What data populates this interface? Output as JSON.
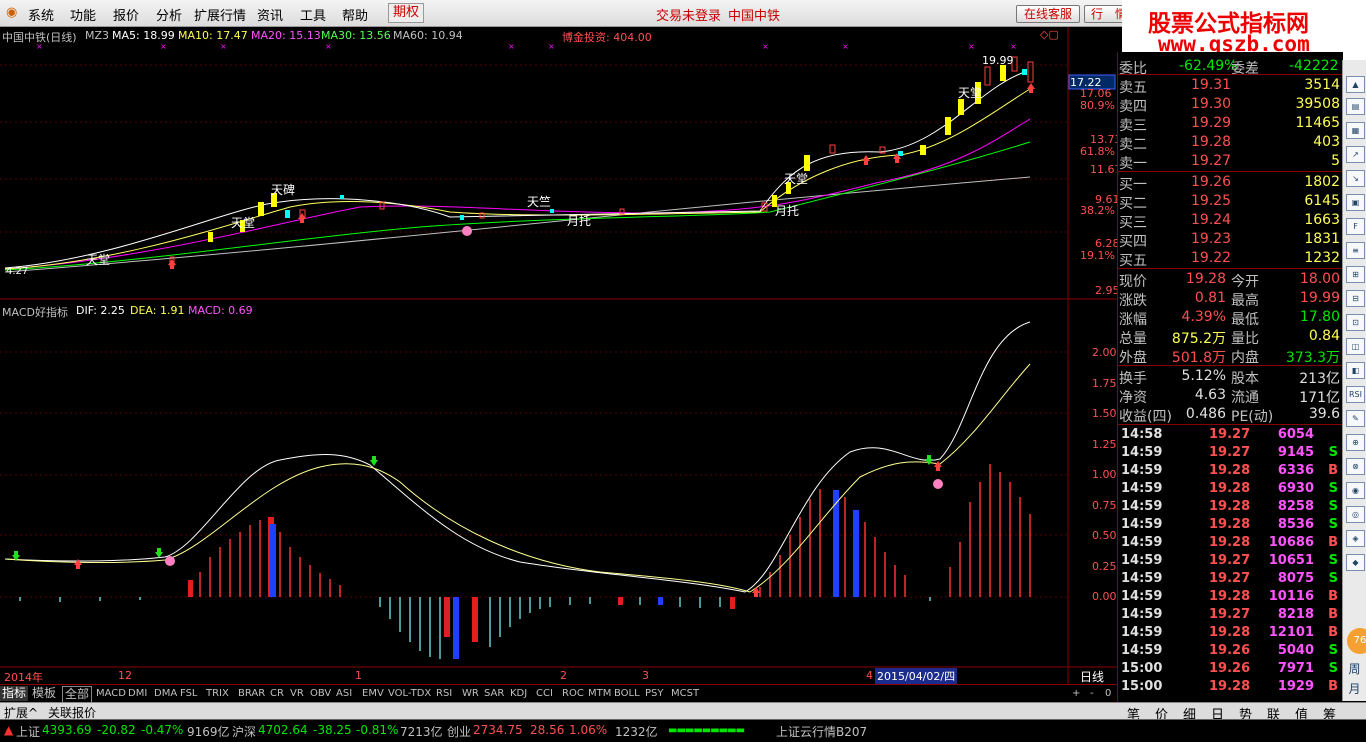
{
  "menu": {
    "items": [
      "系统",
      "功能",
      "报价",
      "分析",
      "扩展行情",
      "资讯",
      "工具",
      "帮助"
    ],
    "futures": "期权",
    "login_status": "交易未登录",
    "stock_title": "中国中铁",
    "service_button": "在线客服",
    "quote_button": "行　情"
  },
  "brand": {
    "line1": "股票公式指标网",
    "line2": "www.gszb.com"
  },
  "main_chart": {
    "legend": {
      "name": "中国中铁(日线)",
      "indicator": "MZ3",
      "ma5": "MA5: 18.99",
      "ma10": "MA10: 17.47",
      "ma20": "MA20: 15.13",
      "ma30": "MA30: 13.56",
      "ma60": "MA60: 10.94"
    },
    "note": "博金投资: 404.00",
    "price_tag": "17.22",
    "axis_labels": [
      "17.06",
      "80.9%",
      "13.73",
      "61.8%",
      "11.67",
      "9.61",
      "38.2%",
      "6.28",
      "19.1%",
      "2.95"
    ],
    "annotations": [
      "天堂",
      "天碑",
      "天堂",
      "天竺",
      "月托",
      "天堂",
      "月托",
      "天堂",
      "月托",
      "天堂",
      "4.27",
      "19.99"
    ],
    "colors": {
      "ma5": "#ffffff",
      "ma10": "#ffff00",
      "ma20": "#ff00ff",
      "ma30": "#00ff00",
      "ma60": "#c0c0c0",
      "up": "#ff4040",
      "down": "#00ffff",
      "yellow_bar": "#ffff00"
    }
  },
  "macd_chart": {
    "legend": {
      "name": "MACD好指标",
      "dif": "DIF: 2.25",
      "dea": "DEA: 1.91",
      "macd": "MACD: 0.69"
    },
    "axis_labels": [
      "2.00",
      "1.75",
      "1.50",
      "1.25",
      "1.00",
      "0.75",
      "0.50",
      "0.25",
      "0.00"
    ]
  },
  "date_axis": {
    "labels": [
      "2014年",
      "12",
      "1",
      "2",
      "3",
      "4"
    ],
    "selected_date": "2015/04/02/四",
    "period": "日线"
  },
  "index_tabs": [
    "指标",
    "模板",
    "全部",
    "MACD",
    "DMI",
    "DMA",
    "FSL",
    "TRIX",
    "BRAR",
    "CR",
    "VR",
    "OBV",
    "ASI",
    "EMV",
    "VOL-TDX",
    "RSI",
    "WR",
    "SAR",
    "KDJ",
    "CCI",
    "ROC",
    "MTM",
    "BOLL",
    "PSY",
    "MCST"
  ],
  "tab_controls": [
    "+",
    "-",
    "0"
  ],
  "bottom_tabs": [
    "扩展^",
    "关联报价"
  ],
  "quote": {
    "weibi": {
      "label1": "委比",
      "value1": "-62.49%",
      "label2": "委差",
      "value2": "-42222"
    },
    "sells": [
      {
        "label": "卖五",
        "price": "19.31",
        "vol": "3514"
      },
      {
        "label": "卖四",
        "price": "19.30",
        "vol": "39508"
      },
      {
        "label": "卖三",
        "price": "19.29",
        "vol": "11465"
      },
      {
        "label": "卖二",
        "price": "19.28",
        "vol": "403"
      },
      {
        "label": "卖一",
        "price": "19.27",
        "vol": "5"
      }
    ],
    "buys": [
      {
        "label": "买一",
        "price": "19.26",
        "vol": "1802"
      },
      {
        "label": "买二",
        "price": "19.25",
        "vol": "6145"
      },
      {
        "label": "买三",
        "price": "19.24",
        "vol": "1663"
      },
      {
        "label": "买四",
        "price": "19.23",
        "vol": "1831"
      },
      {
        "label": "买五",
        "price": "19.22",
        "vol": "1232"
      }
    ],
    "stats": [
      {
        "l1": "现价",
        "v1": "19.28",
        "l2": "今开",
        "v2": "18.00"
      },
      {
        "l1": "涨跌",
        "v1": "0.81",
        "l2": "最高",
        "v2": "19.99"
      },
      {
        "l1": "涨幅",
        "v1": "4.39%",
        "l2": "最低",
        "v2": "17.80"
      },
      {
        "l1": "总量",
        "v1": "875.2万",
        "l2": "量比",
        "v2": "0.84"
      },
      {
        "l1": "外盘",
        "v1": "501.8万",
        "l2": "内盘",
        "v2": "373.3万"
      }
    ],
    "stats2": [
      {
        "l1": "换手",
        "v1": "5.12%",
        "l2": "股本",
        "v2": "213亿"
      },
      {
        "l1": "净资",
        "v1": "4.63",
        "l2": "流通",
        "v2": "171亿"
      },
      {
        "l1": "收益(四)",
        "v1": "0.486",
        "l2": "PE(动)",
        "v2": "39.6"
      }
    ],
    "ticks": [
      {
        "t": "14:58",
        "p": "19.27",
        "v": "6054",
        "s": ""
      },
      {
        "t": "14:59",
        "p": "19.27",
        "v": "9145",
        "s": "S"
      },
      {
        "t": "14:59",
        "p": "19.28",
        "v": "6336",
        "s": "B"
      },
      {
        "t": "14:59",
        "p": "19.28",
        "v": "6930",
        "s": "S"
      },
      {
        "t": "14:59",
        "p": "19.28",
        "v": "8258",
        "s": "S"
      },
      {
        "t": "14:59",
        "p": "19.28",
        "v": "8536",
        "s": "S"
      },
      {
        "t": "14:59",
        "p": "19.28",
        "v": "10686",
        "s": "B"
      },
      {
        "t": "14:59",
        "p": "19.27",
        "v": "10651",
        "s": "S"
      },
      {
        "t": "14:59",
        "p": "19.27",
        "v": "8075",
        "s": "S"
      },
      {
        "t": "14:59",
        "p": "19.28",
        "v": "10116",
        "s": "B"
      },
      {
        "t": "14:59",
        "p": "19.27",
        "v": "8218",
        "s": "B"
      },
      {
        "t": "14:59",
        "p": "19.28",
        "v": "12101",
        "s": "B"
      },
      {
        "t": "14:59",
        "p": "19.26",
        "v": "5040",
        "s": "S"
      },
      {
        "t": "15:00",
        "p": "19.26",
        "v": "7971",
        "s": "S"
      },
      {
        "t": "15:00",
        "p": "19.28",
        "v": "1929",
        "s": "B"
      }
    ]
  },
  "quote_tabs": [
    "笔",
    "价",
    "细",
    "日",
    "势",
    "联",
    "值",
    "筹"
  ],
  "status_bar": {
    "sh": {
      "name": "上证",
      "value": "4393.69",
      "chg": "-20.82",
      "pct": "-0.47%",
      "amt": "9169亿"
    },
    "hs": {
      "name": "沪深",
      "value": "4702.64",
      "chg": "-38.25",
      "pct": "-0.81%",
      "amt": "7213亿"
    },
    "cy": {
      "name": "创业",
      "value": "2734.75",
      "chg": "28.56",
      "pct": "1.06%",
      "amt": "1232亿"
    },
    "cloud": "上证云行情B207"
  },
  "side_strip": {
    "labels": [
      "RSI",
      "76"
    ]
  }
}
